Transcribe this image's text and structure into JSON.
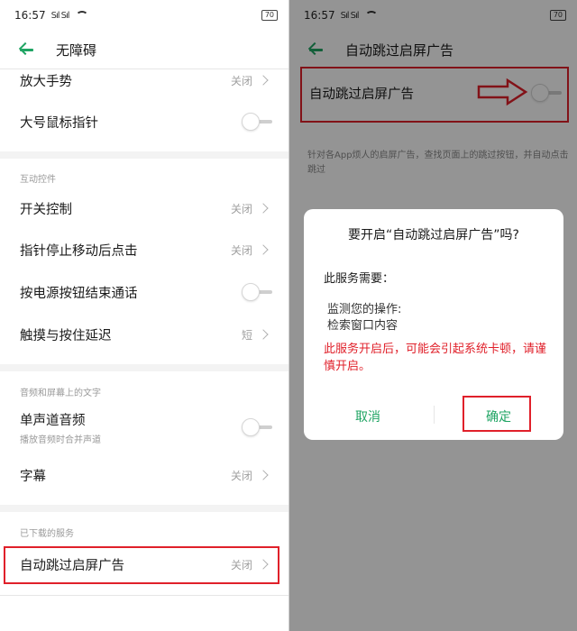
{
  "status_bar": {
    "time": "16:57",
    "signal": "Sıl Sıl",
    "battery": "70"
  },
  "left": {
    "title": "无障碍",
    "items": [
      {
        "label": "放大手势",
        "value": "关闭"
      },
      {
        "label": "大号鼠标指针"
      },
      {
        "label": "开关控制",
        "value": "关闭"
      },
      {
        "label": "指针停止移动后点击",
        "value": "关闭"
      },
      {
        "label": "按电源按钮结束通话"
      },
      {
        "label": "触摸与按住延迟",
        "value": "短"
      },
      {
        "label": "单声道音频",
        "sub": "播放音频时合并声道"
      },
      {
        "label": "字幕",
        "value": "关闭"
      },
      {
        "label": "自动跳过启屏广告",
        "value": "关闭"
      }
    ],
    "sections": [
      "互动控件",
      "音频和屏幕上的文字",
      "已下载的服务"
    ]
  },
  "right": {
    "title": "自动跳过启屏广告",
    "toggle_label": "自动跳过启屏广告",
    "description": "针对各App烦人的启屏广告，查找页面上的跳过按钮，并自动点击跳过",
    "dialog": {
      "title": "要开启“自动跳过启屏广告”吗?",
      "need": "此服务需要：",
      "permissions": [
        "监测您的操作:",
        "检索窗口内容"
      ],
      "warning": "此服务开启后，可能会引起系统卡顿，请谨慎开启。",
      "cancel": "取消",
      "confirm": "确定"
    }
  },
  "colors": {
    "accent": "#1fa463",
    "highlight": "#e0202a",
    "warning": "#e0202a"
  }
}
